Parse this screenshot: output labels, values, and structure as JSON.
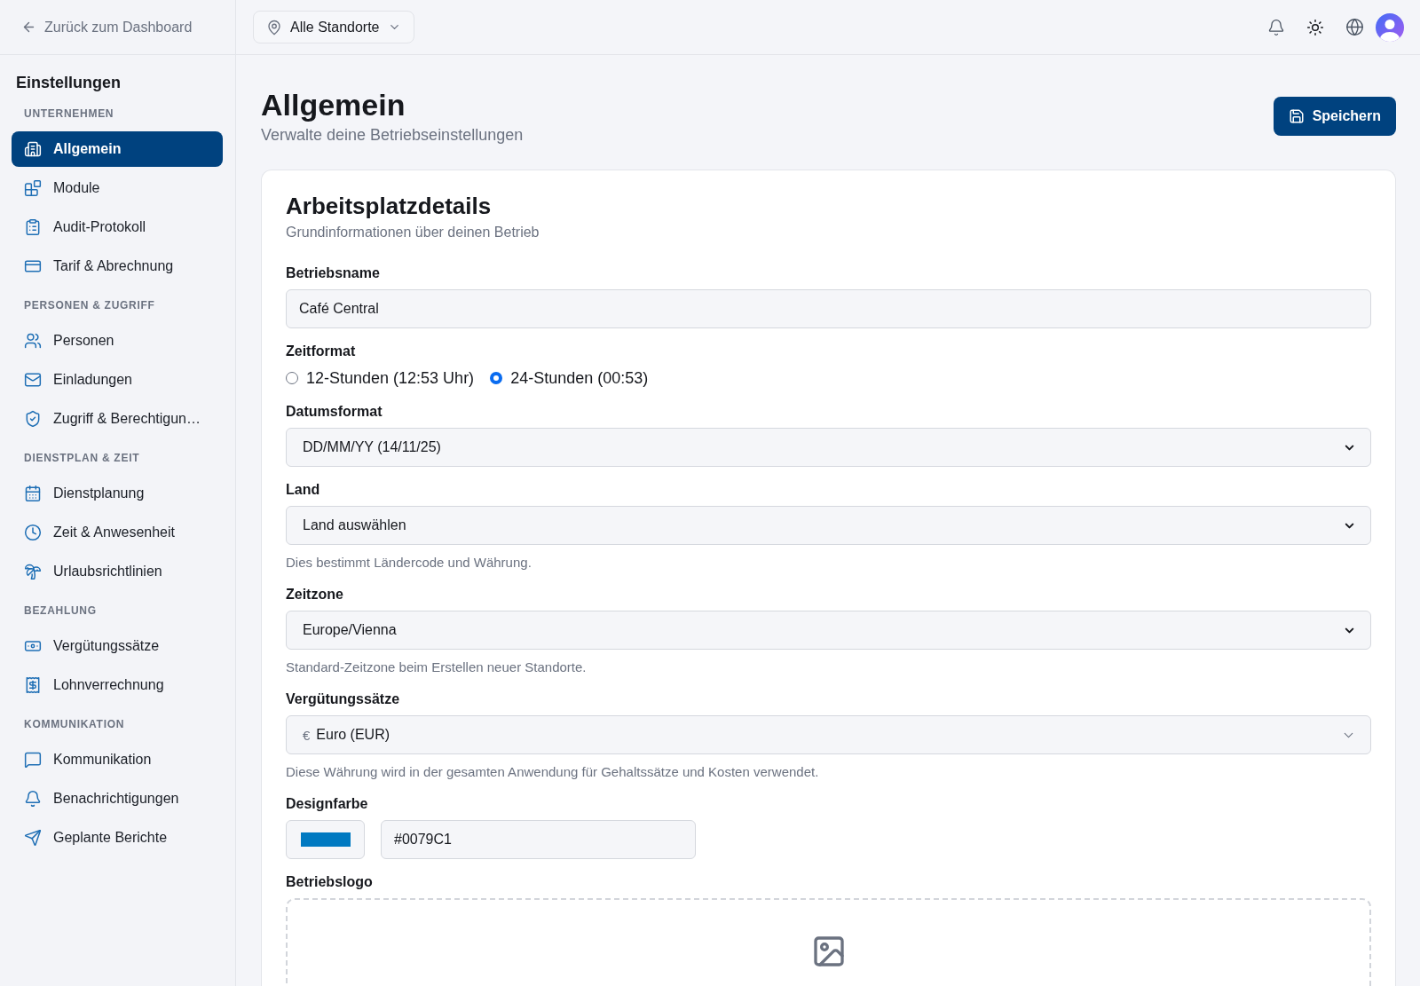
{
  "sidebar": {
    "back_link": "Zurück zum Dashboard",
    "title": "Einstellungen",
    "sections": [
      {
        "heading": "UNTERNEHMEN",
        "items": [
          {
            "label": "Allgemein",
            "selected": true
          },
          {
            "label": "Module",
            "selected": false
          },
          {
            "label": "Audit-Protokoll",
            "selected": false
          },
          {
            "label": "Tarif & Abrechnung",
            "selected": false
          }
        ]
      },
      {
        "heading": "PERSONEN & ZUGRIFF",
        "items": [
          {
            "label": "Personen",
            "selected": false
          },
          {
            "label": "Einladungen",
            "selected": false
          },
          {
            "label": "Zugriff & Berechtigun…",
            "selected": false
          }
        ]
      },
      {
        "heading": "DIENSTPLAN & ZEIT",
        "items": [
          {
            "label": "Dienstplanung",
            "selected": false
          },
          {
            "label": "Zeit & Anwesenheit",
            "selected": false
          },
          {
            "label": "Urlaubsrichtlinien",
            "selected": false
          }
        ]
      },
      {
        "heading": "BEZAHLUNG",
        "items": [
          {
            "label": "Vergütungssätze",
            "selected": false
          },
          {
            "label": "Lohnverrechnung",
            "selected": false
          }
        ]
      },
      {
        "heading": "KOMMUNIKATION",
        "items": [
          {
            "label": "Kommunikation",
            "selected": false
          },
          {
            "label": "Benachrichtigungen",
            "selected": false
          },
          {
            "label": "Geplante Berichte",
            "selected": false
          }
        ]
      }
    ]
  },
  "topbar": {
    "location_picker": "Alle Standorte"
  },
  "page": {
    "title": "Allgemein",
    "subtitle": "Verwalte deine Betriebseinstellungen",
    "save_button": "Speichern"
  },
  "card": {
    "title": "Arbeitsplatzdetails",
    "subtitle": "Grundinformationen über deinen Betrieb",
    "fields": [
      {
        "kind": "text",
        "label": "Betriebsname",
        "value": "Café Central"
      },
      {
        "kind": "radio",
        "label": "Zeitformat",
        "options": [
          {
            "label": "12-Stunden (12:53 Uhr)",
            "selected": false
          },
          {
            "label": "24-Stunden (00:53)",
            "selected": true
          }
        ]
      },
      {
        "kind": "select",
        "label": "Datumsformat",
        "value": "DD/MM/YY (14/11/25)"
      },
      {
        "kind": "select",
        "label": "Land",
        "value": "Land auswählen",
        "hint": "Dies bestimmt Ländercode und Währung."
      },
      {
        "kind": "select",
        "label": "Zeitzone",
        "value": "Europe/Vienna",
        "hint": "Standard-Zeitzone beim Erstellen neuer Standorte."
      },
      {
        "kind": "currency",
        "label": "Vergütungssätze",
        "prefix": "€",
        "value": "Euro (EUR)",
        "hint": "Diese Währung wird in der gesamten Anwendung für Gehaltssätze und Kosten verwendet."
      },
      {
        "kind": "color",
        "label": "Designfarbe",
        "color": "#0079c1",
        "value": "#0079C1"
      },
      {
        "kind": "upload",
        "label": "Betriebslogo"
      }
    ]
  }
}
